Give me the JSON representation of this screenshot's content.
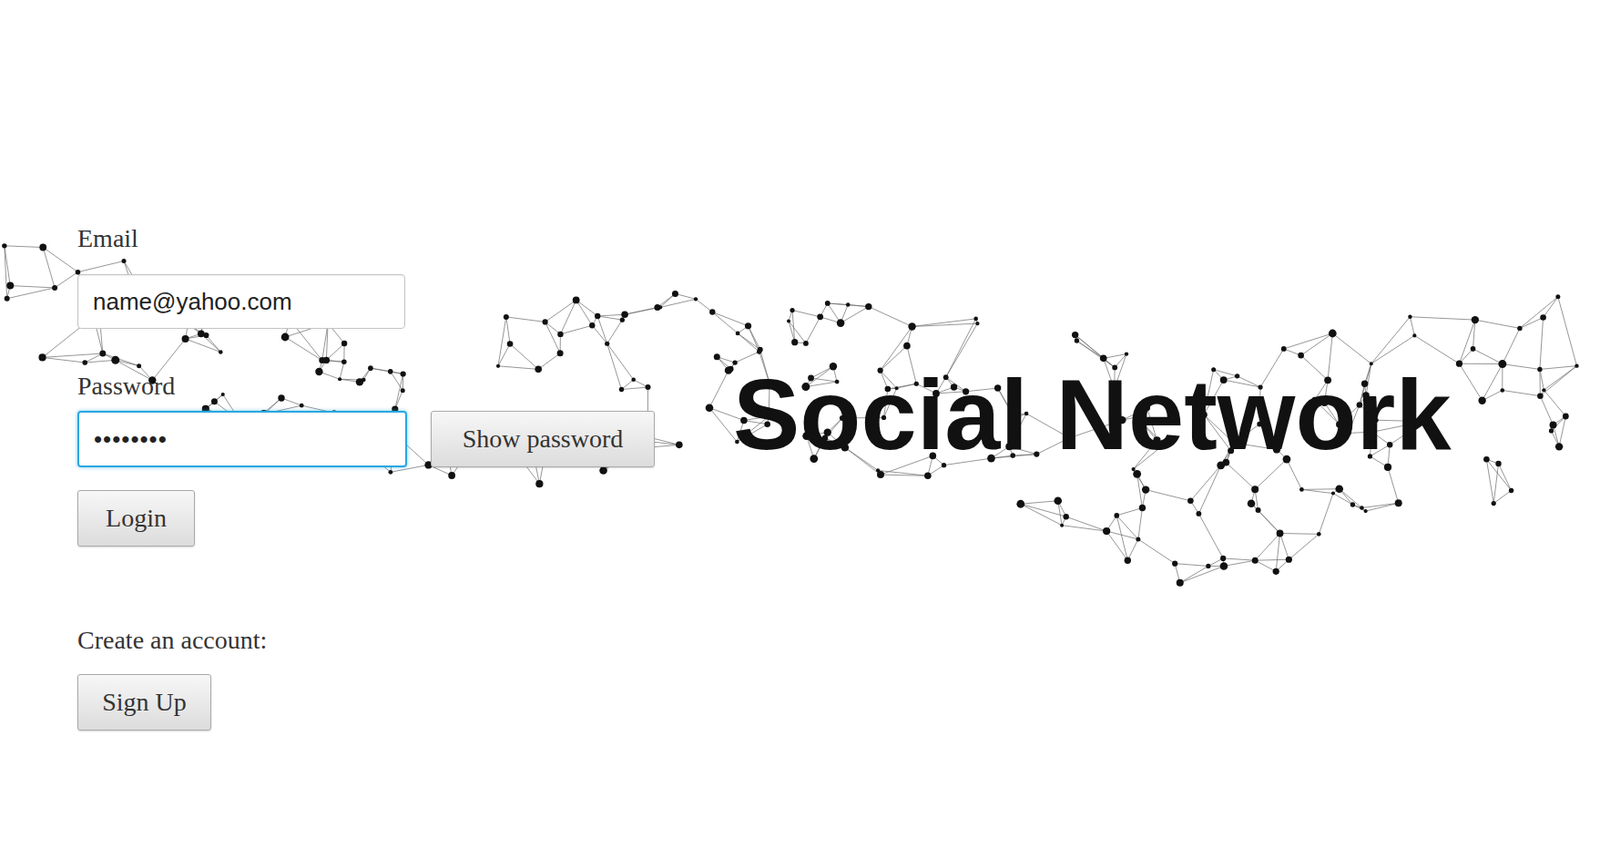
{
  "title": "Social Network",
  "email": {
    "label": "Email",
    "value": "name@yahoo.com"
  },
  "password": {
    "label": "Password",
    "value": "••••••••",
    "focused": true
  },
  "buttons": {
    "show_password": "Show password",
    "login": "Login",
    "sign_up": "Sign Up"
  },
  "create_account_label": "Create an account:"
}
